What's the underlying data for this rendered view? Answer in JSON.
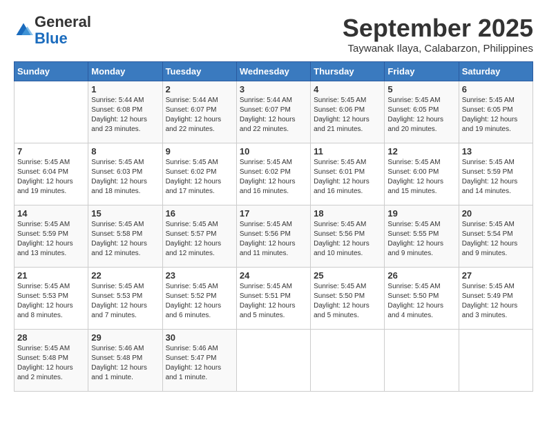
{
  "logo": {
    "general": "General",
    "blue": "Blue"
  },
  "title": "September 2025",
  "location": "Taywanak Ilaya, Calabarzon, Philippines",
  "days_of_week": [
    "Sunday",
    "Monday",
    "Tuesday",
    "Wednesday",
    "Thursday",
    "Friday",
    "Saturday"
  ],
  "weeks": [
    [
      {
        "day": "",
        "info": ""
      },
      {
        "day": "1",
        "info": "Sunrise: 5:44 AM\nSunset: 6:08 PM\nDaylight: 12 hours\nand 23 minutes."
      },
      {
        "day": "2",
        "info": "Sunrise: 5:44 AM\nSunset: 6:07 PM\nDaylight: 12 hours\nand 22 minutes."
      },
      {
        "day": "3",
        "info": "Sunrise: 5:44 AM\nSunset: 6:07 PM\nDaylight: 12 hours\nand 22 minutes."
      },
      {
        "day": "4",
        "info": "Sunrise: 5:45 AM\nSunset: 6:06 PM\nDaylight: 12 hours\nand 21 minutes."
      },
      {
        "day": "5",
        "info": "Sunrise: 5:45 AM\nSunset: 6:05 PM\nDaylight: 12 hours\nand 20 minutes."
      },
      {
        "day": "6",
        "info": "Sunrise: 5:45 AM\nSunset: 6:05 PM\nDaylight: 12 hours\nand 19 minutes."
      }
    ],
    [
      {
        "day": "7",
        "info": "Sunrise: 5:45 AM\nSunset: 6:04 PM\nDaylight: 12 hours\nand 19 minutes."
      },
      {
        "day": "8",
        "info": "Sunrise: 5:45 AM\nSunset: 6:03 PM\nDaylight: 12 hours\nand 18 minutes."
      },
      {
        "day": "9",
        "info": "Sunrise: 5:45 AM\nSunset: 6:02 PM\nDaylight: 12 hours\nand 17 minutes."
      },
      {
        "day": "10",
        "info": "Sunrise: 5:45 AM\nSunset: 6:02 PM\nDaylight: 12 hours\nand 16 minutes."
      },
      {
        "day": "11",
        "info": "Sunrise: 5:45 AM\nSunset: 6:01 PM\nDaylight: 12 hours\nand 16 minutes."
      },
      {
        "day": "12",
        "info": "Sunrise: 5:45 AM\nSunset: 6:00 PM\nDaylight: 12 hours\nand 15 minutes."
      },
      {
        "day": "13",
        "info": "Sunrise: 5:45 AM\nSunset: 5:59 PM\nDaylight: 12 hours\nand 14 minutes."
      }
    ],
    [
      {
        "day": "14",
        "info": "Sunrise: 5:45 AM\nSunset: 5:59 PM\nDaylight: 12 hours\nand 13 minutes."
      },
      {
        "day": "15",
        "info": "Sunrise: 5:45 AM\nSunset: 5:58 PM\nDaylight: 12 hours\nand 12 minutes."
      },
      {
        "day": "16",
        "info": "Sunrise: 5:45 AM\nSunset: 5:57 PM\nDaylight: 12 hours\nand 12 minutes."
      },
      {
        "day": "17",
        "info": "Sunrise: 5:45 AM\nSunset: 5:56 PM\nDaylight: 12 hours\nand 11 minutes."
      },
      {
        "day": "18",
        "info": "Sunrise: 5:45 AM\nSunset: 5:56 PM\nDaylight: 12 hours\nand 10 minutes."
      },
      {
        "day": "19",
        "info": "Sunrise: 5:45 AM\nSunset: 5:55 PM\nDaylight: 12 hours\nand 9 minutes."
      },
      {
        "day": "20",
        "info": "Sunrise: 5:45 AM\nSunset: 5:54 PM\nDaylight: 12 hours\nand 9 minutes."
      }
    ],
    [
      {
        "day": "21",
        "info": "Sunrise: 5:45 AM\nSunset: 5:53 PM\nDaylight: 12 hours\nand 8 minutes."
      },
      {
        "day": "22",
        "info": "Sunrise: 5:45 AM\nSunset: 5:53 PM\nDaylight: 12 hours\nand 7 minutes."
      },
      {
        "day": "23",
        "info": "Sunrise: 5:45 AM\nSunset: 5:52 PM\nDaylight: 12 hours\nand 6 minutes."
      },
      {
        "day": "24",
        "info": "Sunrise: 5:45 AM\nSunset: 5:51 PM\nDaylight: 12 hours\nand 5 minutes."
      },
      {
        "day": "25",
        "info": "Sunrise: 5:45 AM\nSunset: 5:50 PM\nDaylight: 12 hours\nand 5 minutes."
      },
      {
        "day": "26",
        "info": "Sunrise: 5:45 AM\nSunset: 5:50 PM\nDaylight: 12 hours\nand 4 minutes."
      },
      {
        "day": "27",
        "info": "Sunrise: 5:45 AM\nSunset: 5:49 PM\nDaylight: 12 hours\nand 3 minutes."
      }
    ],
    [
      {
        "day": "28",
        "info": "Sunrise: 5:45 AM\nSunset: 5:48 PM\nDaylight: 12 hours\nand 2 minutes."
      },
      {
        "day": "29",
        "info": "Sunrise: 5:46 AM\nSunset: 5:48 PM\nDaylight: 12 hours\nand 1 minute."
      },
      {
        "day": "30",
        "info": "Sunrise: 5:46 AM\nSunset: 5:47 PM\nDaylight: 12 hours\nand 1 minute."
      },
      {
        "day": "",
        "info": ""
      },
      {
        "day": "",
        "info": ""
      },
      {
        "day": "",
        "info": ""
      },
      {
        "day": "",
        "info": ""
      }
    ]
  ]
}
